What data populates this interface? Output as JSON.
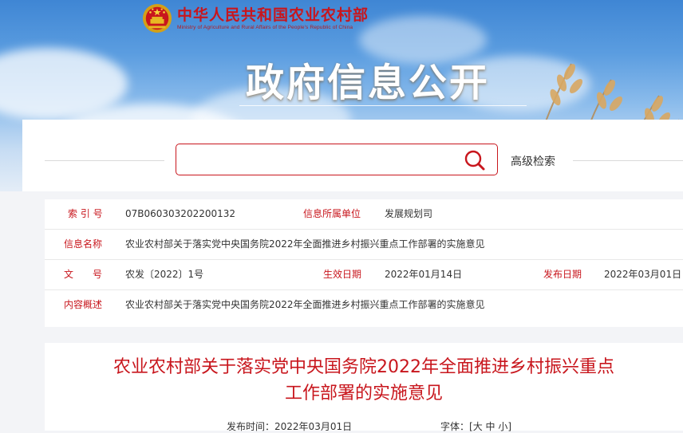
{
  "header": {
    "ministry_cn": "中华人民共和国农业农村部",
    "ministry_en": "Ministry of Agriculture and Rural Affairs of the People's Republic of China",
    "portal_title": "政府信息公开"
  },
  "search": {
    "placeholder": "",
    "icon": "search-icon",
    "advanced_label": "高级检索"
  },
  "info": {
    "index_label": "索 引 号",
    "index_value": "07B060303202200132",
    "unit_label": "信息所属单位",
    "unit_value": "发展规划司",
    "name_label": "信息名称",
    "name_value": "农业农村部关于落实党中央国务院2022年全面推进乡村振兴重点工作部署的实施意见",
    "doc_label": "文　　号",
    "doc_value": "农发〔2022〕1号",
    "effective_label": "生效日期",
    "effective_value": "2022年01月14日",
    "publish_label": "发布日期",
    "publish_value": "2022年03月01日",
    "summary_label": "内容概述",
    "summary_value": "农业农村部关于落实党中央国务院2022年全面推进乡村振兴重点工作部署的实施意见"
  },
  "article": {
    "title_line1": "农业农村部关于落实党中央国务院2022年全面推进乡村振兴重点",
    "title_line2": "工作部署的实施意见",
    "publish_time_label": "发布时间：",
    "publish_time_value": "2022年03月01日",
    "font_label": "字体：",
    "font_open": "[",
    "font_large": "大",
    "font_medium": "中",
    "font_small": "小",
    "font_close": "]"
  },
  "colors": {
    "accent": "#c8161d",
    "sky": "#5b9de0"
  }
}
